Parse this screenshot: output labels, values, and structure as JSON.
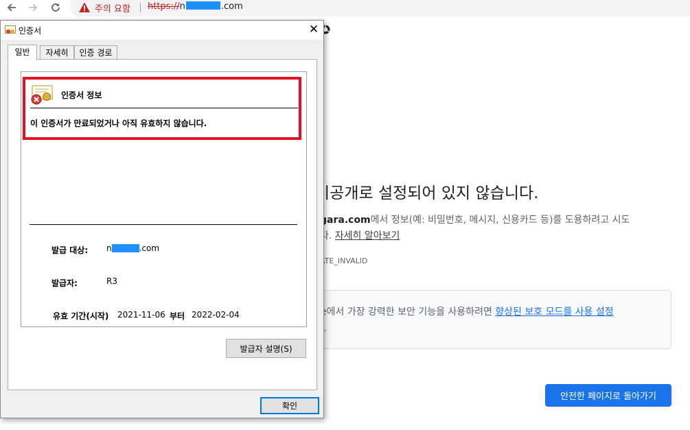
{
  "browser": {
    "security_label": "주의 요함",
    "url_scheme": "https://",
    "url_prefix": "n",
    "url_suffix": ".com"
  },
  "page": {
    "heading": "비공개로 설정되어 있지 않습니다.",
    "description_domain": "gara.com",
    "description_line1": "에서 정보(예: 비밀번호, 메시지, 신용카드 등)를 도용하려고 시도",
    "description_line2": "다.",
    "learn_more": "자세히 알아보기",
    "error_code": "ATE_INVALID",
    "enhanced_prefix": "e에서 가장 강력한 보안 기능을 사용하려면",
    "enhanced_link": "향상된 보호 모드를 사용 설정",
    "enhanced_line2": "..",
    "back_button": "안전한 페이지로 돌아가기"
  },
  "dialog": {
    "title": "인증서",
    "tabs": [
      "일반",
      "자세히",
      "인증 경로"
    ],
    "info_title": "인증서 정보",
    "info_message": "이 인증서가 만료되었거나 아직 유효하지 않습니다.",
    "issued_to_label": "발급 대상:",
    "issued_to_prefix": "n",
    "issued_to_suffix": ".com",
    "issued_by_label": "발급자:",
    "issued_by_value": "R3",
    "validity_label": "유효 기간(시작)",
    "valid_from": "2021-11-06",
    "to_word": "부터",
    "valid_to": "2022-02-04",
    "issuer_statement_button": "발급자 설명(S)",
    "ok_button": "확인"
  },
  "colors": {
    "warning_red": "#c5221f",
    "highlight_red": "#e81123",
    "primary_blue": "#1a73e8",
    "redaction_blue": "#1e90ff"
  }
}
